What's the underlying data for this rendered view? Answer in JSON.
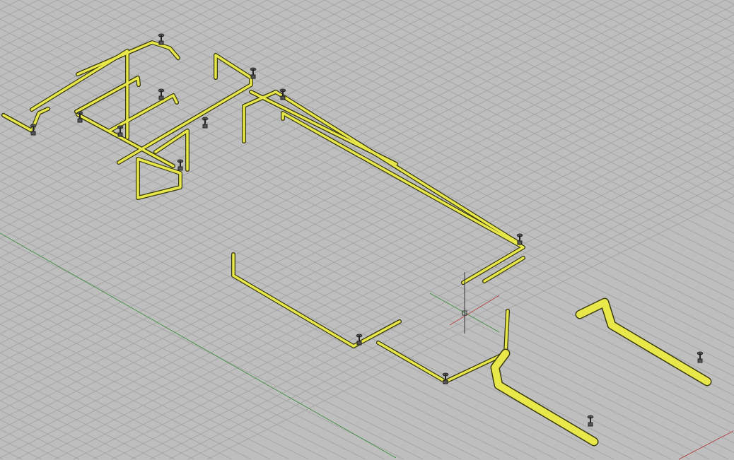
{
  "viewport": {
    "grid_visible": true,
    "cursor_visible": true
  }
}
